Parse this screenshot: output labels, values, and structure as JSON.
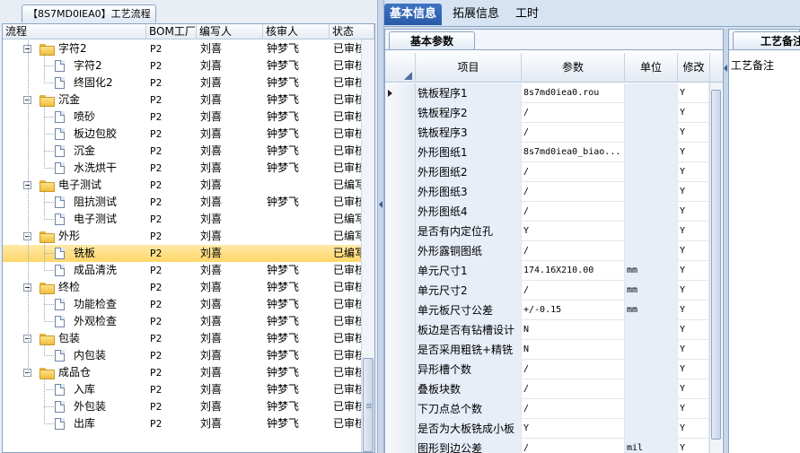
{
  "left_panel": {
    "tab_label": "【8S7MD0IEA0】工艺流程",
    "columns": [
      "流程",
      "BOM工厂",
      "编写人",
      "核审人",
      "状态"
    ],
    "rows": [
      {
        "level": 1,
        "kind": "folder",
        "name": "字符2",
        "bom": "P2",
        "writer": "刘喜",
        "reviewer": "钟梦飞",
        "status": "已审核"
      },
      {
        "level": 2,
        "kind": "doc",
        "name": "字符2",
        "bom": "P2",
        "writer": "刘喜",
        "reviewer": "钟梦飞",
        "status": "已审核"
      },
      {
        "level": 2,
        "kind": "doc",
        "name": "终固化2",
        "bom": "P2",
        "writer": "刘喜",
        "reviewer": "钟梦飞",
        "status": "已审核"
      },
      {
        "level": 1,
        "kind": "folder",
        "name": "沉金",
        "bom": "P2",
        "writer": "刘喜",
        "reviewer": "钟梦飞",
        "status": "已审核"
      },
      {
        "level": 2,
        "kind": "doc",
        "name": "喷砂",
        "bom": "P2",
        "writer": "刘喜",
        "reviewer": "钟梦飞",
        "status": "已审核"
      },
      {
        "level": 2,
        "kind": "doc",
        "name": "板边包胶",
        "bom": "P2",
        "writer": "刘喜",
        "reviewer": "钟梦飞",
        "status": "已审核"
      },
      {
        "level": 2,
        "kind": "doc",
        "name": "沉金",
        "bom": "P2",
        "writer": "刘喜",
        "reviewer": "钟梦飞",
        "status": "已审核"
      },
      {
        "level": 2,
        "kind": "doc",
        "name": "水洗烘干",
        "bom": "P2",
        "writer": "刘喜",
        "reviewer": "钟梦飞",
        "status": "已审核"
      },
      {
        "level": 1,
        "kind": "folder",
        "name": "电子测试",
        "bom": "P2",
        "writer": "刘喜",
        "reviewer": "",
        "status": "已编写"
      },
      {
        "level": 2,
        "kind": "doc",
        "name": "阻抗测试",
        "bom": "P2",
        "writer": "刘喜",
        "reviewer": "钟梦飞",
        "status": "已审核"
      },
      {
        "level": 2,
        "kind": "doc",
        "name": "电子测试",
        "bom": "P2",
        "writer": "刘喜",
        "reviewer": "",
        "status": "已编写"
      },
      {
        "level": 1,
        "kind": "folder",
        "name": "外形",
        "bom": "P2",
        "writer": "刘喜",
        "reviewer": "",
        "status": "已编写"
      },
      {
        "level": 2,
        "kind": "doc",
        "name": "铣板",
        "bom": "P2",
        "writer": "刘喜",
        "reviewer": "",
        "status": "已编写",
        "selected": true
      },
      {
        "level": 2,
        "kind": "doc",
        "name": "成品清洗",
        "bom": "P2",
        "writer": "刘喜",
        "reviewer": "钟梦飞",
        "status": "已审核"
      },
      {
        "level": 1,
        "kind": "folder",
        "name": "终检",
        "bom": "P2",
        "writer": "刘喜",
        "reviewer": "钟梦飞",
        "status": "已审核"
      },
      {
        "level": 2,
        "kind": "doc",
        "name": "功能检查",
        "bom": "P2",
        "writer": "刘喜",
        "reviewer": "钟梦飞",
        "status": "已审核"
      },
      {
        "level": 2,
        "kind": "doc",
        "name": "外观检查",
        "bom": "P2",
        "writer": "刘喜",
        "reviewer": "钟梦飞",
        "status": "已审核"
      },
      {
        "level": 1,
        "kind": "folder",
        "name": "包装",
        "bom": "P2",
        "writer": "刘喜",
        "reviewer": "钟梦飞",
        "status": "已审核"
      },
      {
        "level": 2,
        "kind": "doc",
        "name": "内包装",
        "bom": "P2",
        "writer": "刘喜",
        "reviewer": "钟梦飞",
        "status": "已审核"
      },
      {
        "level": 1,
        "kind": "folder",
        "name": "成品仓",
        "bom": "P2",
        "writer": "刘喜",
        "reviewer": "钟梦飞",
        "status": "已审核"
      },
      {
        "level": 2,
        "kind": "doc",
        "name": "入库",
        "bom": "P2",
        "writer": "刘喜",
        "reviewer": "钟梦飞",
        "status": "已审核"
      },
      {
        "level": 2,
        "kind": "doc",
        "name": "外包装",
        "bom": "P2",
        "writer": "刘喜",
        "reviewer": "钟梦飞",
        "status": "已审核"
      },
      {
        "level": 2,
        "kind": "doc",
        "name": "出库",
        "bom": "P2",
        "writer": "刘喜",
        "reviewer": "钟梦飞",
        "status": "已审核"
      }
    ]
  },
  "top_tabs": [
    {
      "label": "基本信息",
      "active": true
    },
    {
      "label": "拓展信息",
      "active": false
    },
    {
      "label": "工时",
      "active": false
    }
  ],
  "grid": {
    "tab_label": "基本参数",
    "columns": [
      "项目",
      "参数",
      "单位",
      "修改"
    ],
    "rows": [
      {
        "item": "铣板程序1",
        "param": "8s7md0iea0.rou",
        "unit": "",
        "mod": "Y",
        "current": true
      },
      {
        "item": "铣板程序2",
        "param": "/",
        "unit": "",
        "mod": "Y"
      },
      {
        "item": "铣板程序3",
        "param": "/",
        "unit": "",
        "mod": "Y"
      },
      {
        "item": "外形图纸1",
        "param": "8s7md0iea0_biao...",
        "unit": "",
        "mod": "Y"
      },
      {
        "item": "外形图纸2",
        "param": "/",
        "unit": "",
        "mod": "Y"
      },
      {
        "item": "外形图纸3",
        "param": "/",
        "unit": "",
        "mod": "Y"
      },
      {
        "item": "外形图纸4",
        "param": "/",
        "unit": "",
        "mod": "Y"
      },
      {
        "item": "是否有内定位孔",
        "param": "Y",
        "unit": "",
        "mod": "Y"
      },
      {
        "item": "外形露铜图纸",
        "param": "/",
        "unit": "",
        "mod": "Y"
      },
      {
        "item": "单元尺寸1",
        "param": "174.16X210.00",
        "unit": "mm",
        "mod": "Y"
      },
      {
        "item": "单元尺寸2",
        "param": "/",
        "unit": "mm",
        "mod": "Y"
      },
      {
        "item": "单元板尺寸公差",
        "param": "+/-0.15",
        "unit": "mm",
        "mod": "Y"
      },
      {
        "item": "板边是否有钻槽设计",
        "param": "N",
        "unit": "",
        "mod": "Y"
      },
      {
        "item": "是否采用粗铣+精铣",
        "param": "N",
        "unit": "",
        "mod": "Y"
      },
      {
        "item": "异形槽个数",
        "param": "/",
        "unit": "",
        "mod": "Y"
      },
      {
        "item": "叠板块数",
        "param": "/",
        "unit": "",
        "mod": "Y"
      },
      {
        "item": "下刀点总个数",
        "param": "/",
        "unit": "",
        "mod": "Y"
      },
      {
        "item": "是否为大板铣成小板",
        "param": "Y",
        "unit": "",
        "mod": "Y"
      },
      {
        "item": "图形到边公差",
        "param": "/",
        "unit": "mil",
        "mod": "Y"
      }
    ]
  },
  "notes": {
    "tab_label": "工艺备注",
    "label": "工艺备注"
  }
}
